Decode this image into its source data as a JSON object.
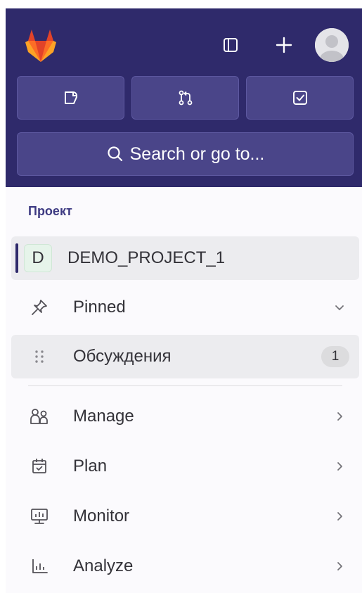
{
  "header": {
    "logo_icon": "gitlab-tanuki-icon",
    "toggle_icon": "sidebar-toggle-icon",
    "plus_label": "+",
    "avatar_icon": "user-avatar-icon",
    "quick_actions": [
      {
        "name": "issues",
        "icon": "issues-icon"
      },
      {
        "name": "merge-requests",
        "icon": "merge-request-icon"
      },
      {
        "name": "todos",
        "icon": "todo-checkbox-icon"
      }
    ],
    "search_label": "Search or go to..."
  },
  "nav": {
    "section_label": "Проект",
    "project": {
      "avatar_letter": "D",
      "label": "DEMO_PROJECT_1"
    },
    "pinned": {
      "label": "Pinned",
      "icon": "thumbtack-icon"
    },
    "discussions": {
      "label": "Обсуждения",
      "count": "1",
      "icon": "drag-handle-icon"
    },
    "items": [
      {
        "label": "Manage",
        "icon": "users-icon"
      },
      {
        "label": "Plan",
        "icon": "calendar-check-icon"
      },
      {
        "label": "Monitor",
        "icon": "monitor-icon"
      },
      {
        "label": "Analyze",
        "icon": "chart-icon"
      }
    ]
  },
  "colors": {
    "header_bg": "#2f2a6b",
    "button_bg": "#4a4589",
    "section_label": "#3d3a82",
    "active_bg": "#ececef",
    "logo_orange": "#fc6d26",
    "logo_red": "#e24329"
  }
}
